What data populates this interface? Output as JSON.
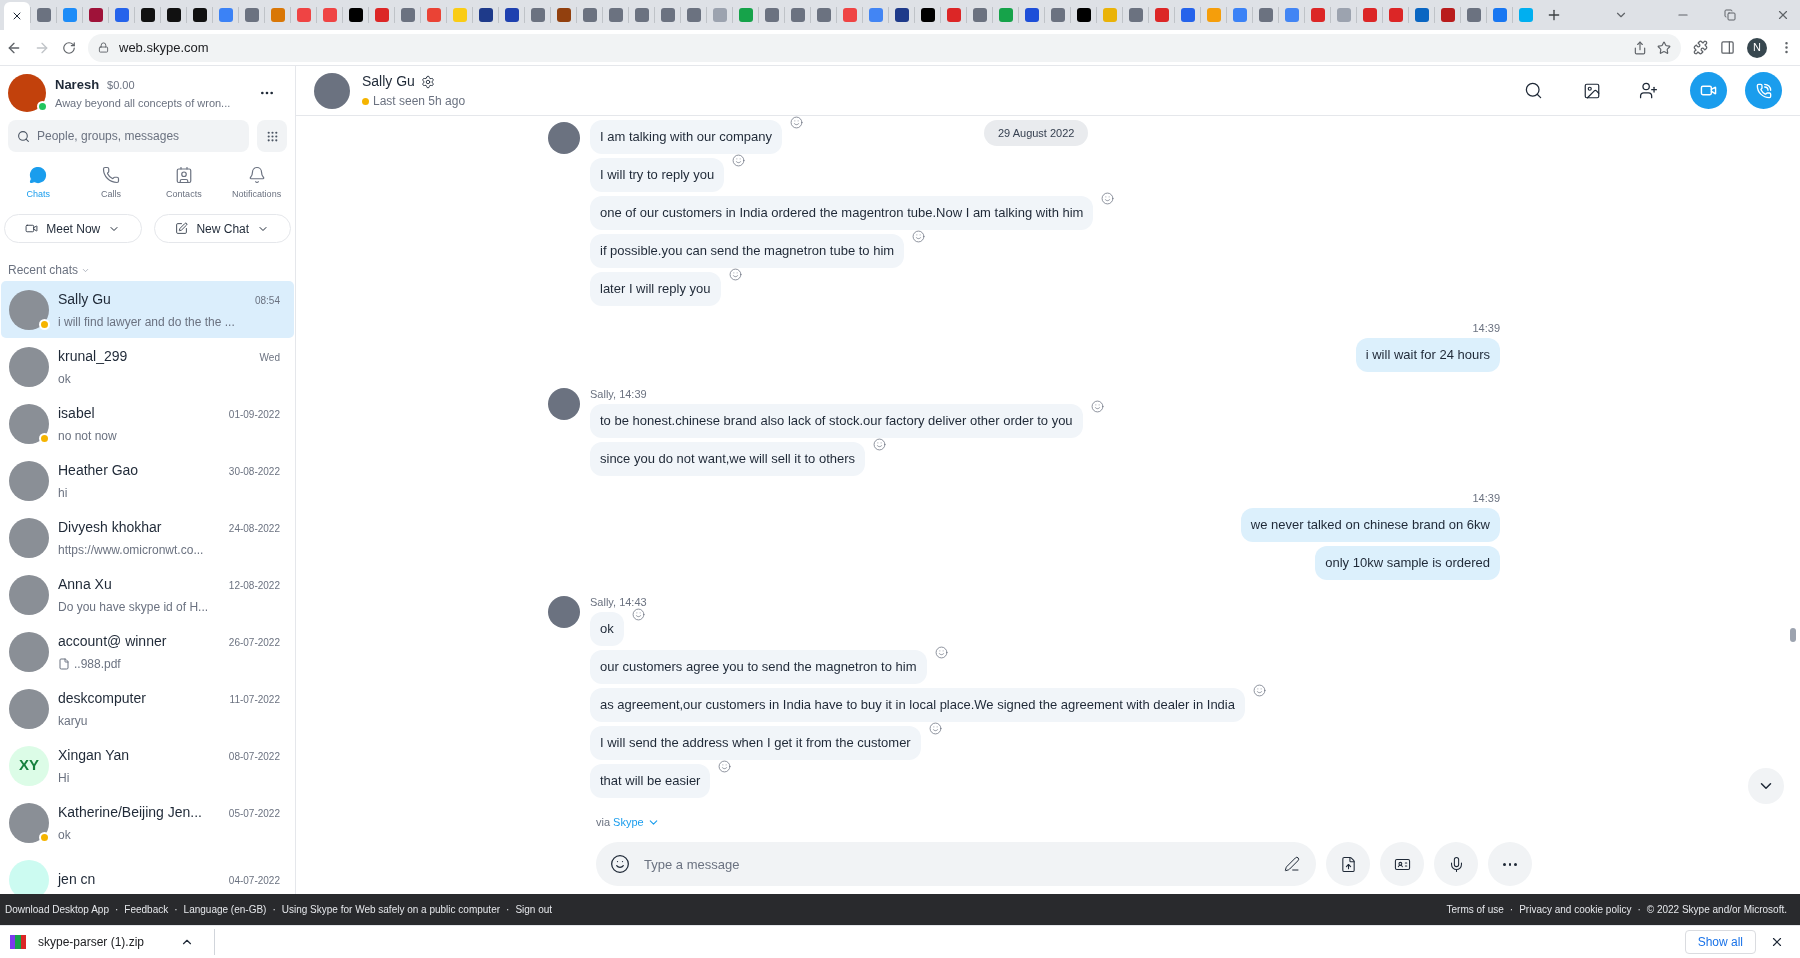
{
  "browser": {
    "url": "web.skype.com",
    "profile_initial": "N"
  },
  "profile": {
    "name": "Naresh",
    "credit": "$0.00",
    "mood": "Away beyond all concepts of wron...",
    "color": "#22c55e"
  },
  "search": {
    "placeholder": "People, groups, messages"
  },
  "nav": [
    {
      "label": "Chats",
      "kind": "chats",
      "selected": true
    },
    {
      "label": "Calls",
      "kind": "calls",
      "selected": false
    },
    {
      "label": "Contacts",
      "kind": "contacts",
      "selected": false
    },
    {
      "label": "Notifications",
      "kind": "notifications",
      "selected": false
    }
  ],
  "actions": [
    {
      "label": "Meet Now",
      "kind": "meet"
    },
    {
      "label": "New Chat",
      "kind": "new"
    }
  ],
  "recent_label": "Recent chats",
  "chats": [
    {
      "name": "Sally Gu",
      "preview": "i will find lawyer and do the the ...",
      "time": "08:54",
      "selected": true,
      "color": "#f5b400",
      "kind": "photo"
    },
    {
      "name": "krunal_299",
      "preview": "ok",
      "time": "Wed",
      "selected": false,
      "kind": "photo"
    },
    {
      "name": "isabel",
      "preview": "no not now",
      "time": "01-09-2022",
      "selected": false,
      "color": "#f5b400",
      "kind": "photo"
    },
    {
      "name": "Heather Gao",
      "preview": "hi",
      "time": "30-08-2022",
      "selected": false,
      "kind": "photo"
    },
    {
      "name": "Divyesh khokhar",
      "preview": "https://www.omicronwt.co...",
      "time": "24-08-2022",
      "selected": false,
      "kind": "photo"
    },
    {
      "name": "Anna Xu",
      "preview": "Do you have skype id of H...",
      "time": "12-08-2022",
      "selected": false,
      "kind": "photo"
    },
    {
      "name": "account@ winner",
      "preview": "..988.pdf",
      "attachment": true,
      "time": "26-07-2022",
      "selected": false,
      "kind": "photo"
    },
    {
      "name": "deskcomputer",
      "preview": "karyu",
      "time": "11-07-2022",
      "selected": false,
      "kind": "photo"
    },
    {
      "name": "Xingan  Yan",
      "preview": "Hi",
      "time": "08-07-2022",
      "selected": false,
      "kind": "initials",
      "initials": "XY"
    },
    {
      "name": "Katherine/Beijing Jen...",
      "preview": "ok",
      "time": "05-07-2022",
      "selected": false,
      "color": "#f5b400",
      "kind": "photo"
    },
    {
      "name": "jen cn",
      "time": "04-07-2022",
      "selected": false,
      "kind": "blank"
    }
  ],
  "conversation": {
    "name": "Sally Gu",
    "status": "Last seen 5h ago",
    "color": "#f5b400"
  },
  "date_pill": "29 August 2022",
  "messages": [
    {
      "kind": "incoming",
      "texts": [
        "I am talking with our company",
        "I will try to reply you",
        "one of our customers in India ordered the magentron tube.Now I am talking with him",
        "if possible.you can send the magnetron tube to him",
        "later I will reply you"
      ]
    },
    {
      "kind": "outgoing",
      "header": "14:39",
      "texts": [
        "i will wait for 24 hours"
      ]
    },
    {
      "kind": "incoming",
      "header": "Sally, 14:39",
      "texts": [
        "to be honest.chinese brand also lack of stock.our factory deliver other order to you",
        "since you do not want,we will sell it to others"
      ]
    },
    {
      "kind": "outgoing",
      "header": "14:39",
      "texts": [
        "we never talked on chinese brand on 6kw",
        "only 10kw sample is ordered"
      ]
    },
    {
      "kind": "incoming",
      "header": "Sally, 14:43",
      "texts": [
        "ok",
        "our customers agree you to send the magnetron to him",
        "as agreement,our customers in India have to buy it in local place.We signed the agreement with dealer in India",
        "I will send the address when I get it from the customer",
        "that will be easier"
      ]
    }
  ],
  "via": {
    "prefix": "via",
    "link": "Skype"
  },
  "composer": {
    "placeholder": "Type a message"
  },
  "footer": {
    "separator": "·",
    "left": [
      "Download Desktop App",
      "Feedback",
      "Language (en-GB)",
      "Using Skype for Web safely on a public computer",
      "Sign out"
    ],
    "right": [
      "Terms of use",
      "Privacy and cookie policy",
      "© 2022 Skype and/or Microsoft."
    ]
  },
  "download": {
    "file": "skype-parser (1).zip",
    "show_all": "Show all"
  }
}
